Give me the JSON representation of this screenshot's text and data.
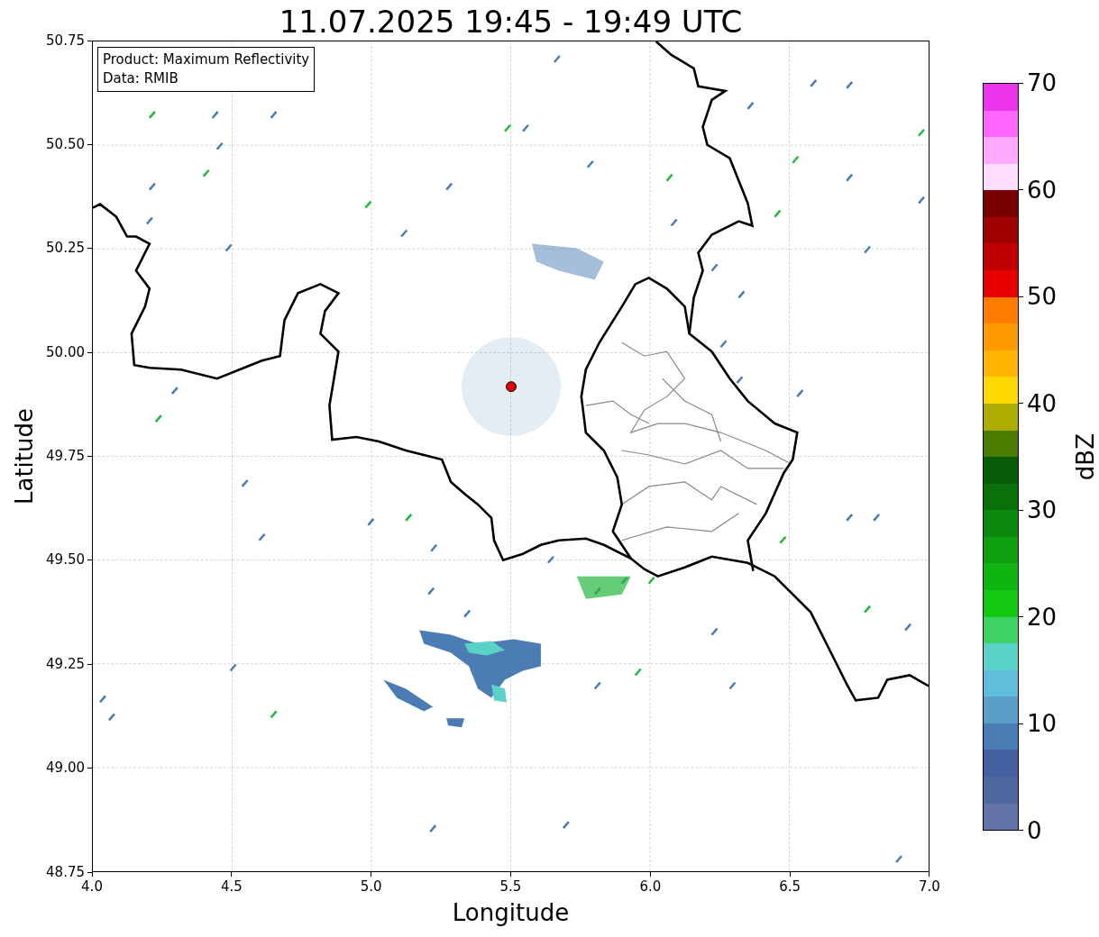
{
  "title": "11.07.2025 19:45 - 19:49 UTC",
  "plot": {
    "legend": [
      "Product: Maximum Reflectivity",
      "Data: RMIB"
    ],
    "xlabel": "Longitude",
    "ylabel": "Latitude",
    "xticks": [
      "4.0",
      "4.5",
      "5.0",
      "5.5",
      "6.0",
      "6.5",
      "7.0"
    ],
    "yticks": [
      "50.75",
      "50.50",
      "50.25",
      "50.00",
      "49.75",
      "49.50",
      "49.25",
      "49.00",
      "48.75"
    ]
  },
  "colorbar": {
    "label": "dBZ",
    "ticks": [
      "70",
      "60",
      "50",
      "40",
      "30",
      "20",
      "10",
      "0"
    ],
    "segments": [
      {
        "color": "#ee35ee"
      },
      {
        "color": "#fe66fe"
      },
      {
        "color": "#ffaaff"
      },
      {
        "color": "#ffddff"
      },
      {
        "color": "#780000"
      },
      {
        "color": "#a00000"
      },
      {
        "color": "#c00000"
      },
      {
        "color": "#e60000"
      },
      {
        "color": "#ff7c00"
      },
      {
        "color": "#ff9a00"
      },
      {
        "color": "#ffb400"
      },
      {
        "color": "#ffd800"
      },
      {
        "color": "#adad00"
      },
      {
        "color": "#4a7c00"
      },
      {
        "color": "#075d07"
      },
      {
        "color": "#0a700a"
      },
      {
        "color": "#0c880c"
      },
      {
        "color": "#0ea00e"
      },
      {
        "color": "#10b410"
      },
      {
        "color": "#12c812"
      },
      {
        "color": "#3cd264"
      },
      {
        "color": "#5ad2c8"
      },
      {
        "color": "#5ebedc"
      },
      {
        "color": "#5a9fc8"
      },
      {
        "color": "#4b7db4"
      },
      {
        "color": "#4560a0"
      },
      {
        "color": "#4f68a0"
      },
      {
        "color": "#6474a8"
      }
    ]
  }
}
